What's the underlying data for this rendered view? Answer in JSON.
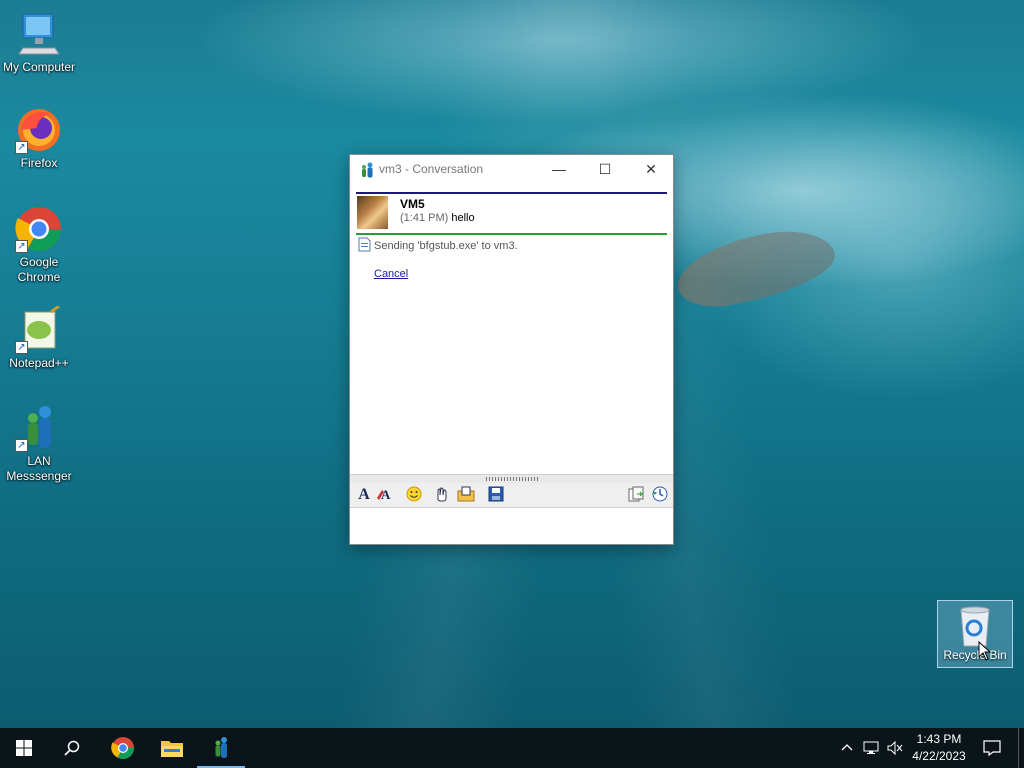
{
  "desktop": {
    "icons": [
      {
        "label": "My Computer"
      },
      {
        "label": "Firefox"
      },
      {
        "label": "Google Chrome"
      },
      {
        "label": "Notepad++"
      },
      {
        "label": "LAN Messsenger"
      }
    ],
    "recycle_bin": {
      "label": "Recycle Bin"
    }
  },
  "window": {
    "title": "vm3 - Conversation",
    "minimize_glyph": "—",
    "maximize_glyph": "☐",
    "close_glyph": "✕",
    "message": {
      "sender": "VM5",
      "time": "(1:41 PM)",
      "text": "hello"
    },
    "transfer_status": "Sending 'bfgstub.exe' to vm3.",
    "cancel_label": "Cancel",
    "toolbar": {
      "font_icon": "font-icon",
      "font_color_icon": "font-color-icon",
      "emoticon_icon": "smiley-icon",
      "nudge_icon": "nudge-icon",
      "send_file_icon": "send-file-icon",
      "save_icon": "save-icon",
      "copy_icon": "copy-icon",
      "history_icon": "history-icon"
    },
    "input_value": ""
  },
  "taskbar": {
    "clock_time": "1:43 PM",
    "clock_date": "4/22/2023"
  },
  "colors": {
    "navy_rule": "#1a1a7a",
    "green_rule": "#22a034",
    "link": "#1a1aa8",
    "taskbar": "#0b1418",
    "active_indicator": "#76b9ed"
  }
}
